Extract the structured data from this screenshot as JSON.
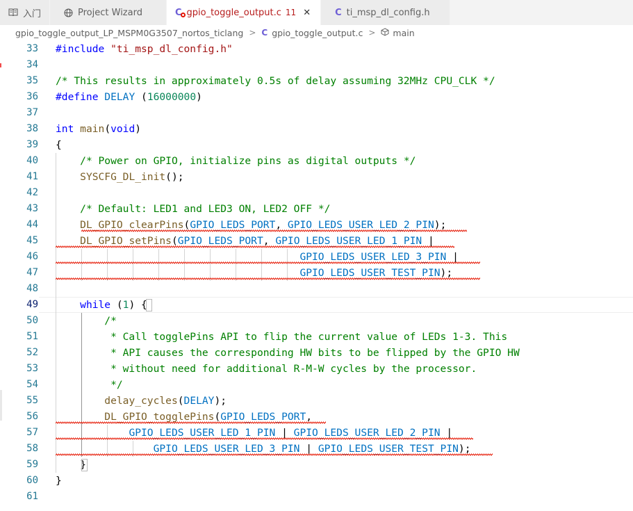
{
  "tabs": [
    {
      "icon": "book-icon",
      "label": "入门",
      "active": false
    },
    {
      "icon": "globe-icon",
      "label": "Project Wizard",
      "active": false
    },
    {
      "icon": "c-file-error-icon",
      "label": "gpio_toggle_output.c",
      "badge": "11",
      "active": true
    },
    {
      "icon": "c-file-icon",
      "label": "ti_msp_dl_config.h",
      "active": false
    }
  ],
  "breadcrumb": {
    "project": "gpio_toggle_output_LP_MSPM0G3507_nortos_ticlang",
    "file": "gpio_toggle_output.c",
    "symbol": "main"
  },
  "editor": {
    "lines": [
      {
        "n": "33",
        "tokens": [
          [
            "pp",
            "#include "
          ],
          [
            "str",
            "\"ti_msp_dl_config.h\""
          ]
        ]
      },
      {
        "n": "34",
        "tokens": []
      },
      {
        "n": "35",
        "tokens": [
          [
            "cm",
            "/* This results in approximately 0.5s of delay assuming 32MHz CPU_CLK */"
          ]
        ]
      },
      {
        "n": "36",
        "tokens": [
          [
            "pp",
            "#define "
          ],
          [
            "mac",
            "DELAY "
          ],
          [
            "pl",
            "("
          ],
          [
            "num",
            "16000000"
          ],
          [
            "pl",
            ")"
          ]
        ]
      },
      {
        "n": "37",
        "tokens": []
      },
      {
        "n": "38",
        "tokens": [
          [
            "kw",
            "int "
          ],
          [
            "fn",
            "main"
          ],
          [
            "pl",
            "("
          ],
          [
            "kw",
            "void"
          ],
          [
            "pl",
            ")"
          ]
        ]
      },
      {
        "n": "39",
        "tokens": [
          [
            "pl",
            "{"
          ]
        ]
      },
      {
        "n": "40",
        "tokens": [
          [
            "pl",
            "    "
          ],
          [
            "cm",
            "/* Power on GPIO, initialize pins as digital outputs */"
          ]
        ]
      },
      {
        "n": "41",
        "tokens": [
          [
            "pl",
            "    "
          ],
          [
            "fn",
            "SYSCFG_DL_init"
          ],
          [
            "pl",
            "();"
          ]
        ]
      },
      {
        "n": "42",
        "tokens": []
      },
      {
        "n": "43",
        "tokens": [
          [
            "pl",
            "    "
          ],
          [
            "cm",
            "/* Default: LED1 and LED3 ON, LED2 OFF */"
          ]
        ]
      },
      {
        "n": "44",
        "tokens": [
          [
            "pl",
            "    "
          ],
          [
            "fn",
            "DL_GPIO_clearPins"
          ],
          [
            "pl",
            "("
          ],
          [
            "mac",
            "GPIO_LEDS_PORT"
          ],
          [
            "pl",
            ", "
          ],
          [
            "mac",
            "GPIO_LEDS_USER_LED_2_PIN"
          ],
          [
            "pl",
            ");"
          ]
        ]
      },
      {
        "n": "45",
        "tokens": [
          [
            "pl",
            "    "
          ],
          [
            "fn",
            "DL_GPIO_setPins"
          ],
          [
            "pl",
            "("
          ],
          [
            "mac",
            "GPIO_LEDS_PORT"
          ],
          [
            "pl",
            ", "
          ],
          [
            "mac",
            "GPIO_LEDS_USER_LED_1_PIN"
          ],
          [
            "pl",
            " |"
          ]
        ]
      },
      {
        "n": "46",
        "tokens": [
          [
            "pl",
            "                                        "
          ],
          [
            "mac",
            "GPIO_LEDS_USER_LED_3_PIN"
          ],
          [
            "pl",
            " |"
          ]
        ]
      },
      {
        "n": "47",
        "tokens": [
          [
            "pl",
            "                                        "
          ],
          [
            "mac",
            "GPIO_LEDS_USER_TEST_PIN"
          ],
          [
            "pl",
            ");"
          ]
        ]
      },
      {
        "n": "48",
        "tokens": []
      },
      {
        "n": "49",
        "tokens": [
          [
            "pl",
            "    "
          ],
          [
            "kw",
            "while"
          ],
          [
            "pl",
            " ("
          ],
          [
            "num",
            "1"
          ],
          [
            "pl",
            ") {"
          ]
        ]
      },
      {
        "n": "50",
        "tokens": [
          [
            "pl",
            "        "
          ],
          [
            "cm",
            "/*"
          ]
        ]
      },
      {
        "n": "51",
        "tokens": [
          [
            "pl",
            "         "
          ],
          [
            "cm",
            "* Call togglePins API to flip the current value of LEDs 1-3. This"
          ]
        ]
      },
      {
        "n": "52",
        "tokens": [
          [
            "pl",
            "         "
          ],
          [
            "cm",
            "* API causes the corresponding HW bits to be flipped by the GPIO HW"
          ]
        ]
      },
      {
        "n": "53",
        "tokens": [
          [
            "pl",
            "         "
          ],
          [
            "cm",
            "* without need for additional R-M-W cycles by the processor."
          ]
        ]
      },
      {
        "n": "54",
        "tokens": [
          [
            "pl",
            "         "
          ],
          [
            "cm",
            "*/"
          ]
        ]
      },
      {
        "n": "55",
        "tokens": [
          [
            "pl",
            "        "
          ],
          [
            "fn",
            "delay_cycles"
          ],
          [
            "pl",
            "("
          ],
          [
            "mac",
            "DELAY"
          ],
          [
            "pl",
            ");"
          ]
        ]
      },
      {
        "n": "56",
        "tokens": [
          [
            "pl",
            "        "
          ],
          [
            "fn",
            "DL_GPIO_togglePins"
          ],
          [
            "pl",
            "("
          ],
          [
            "mac",
            "GPIO_LEDS_PORT"
          ],
          [
            "pl",
            ","
          ]
        ]
      },
      {
        "n": "57",
        "tokens": [
          [
            "pl",
            "            "
          ],
          [
            "mac",
            "GPIO_LEDS_USER_LED_1_PIN"
          ],
          [
            "pl",
            " | "
          ],
          [
            "mac",
            "GPIO_LEDS_USER_LED_2_PIN"
          ],
          [
            "pl",
            " |"
          ]
        ]
      },
      {
        "n": "58",
        "tokens": [
          [
            "pl",
            "                "
          ],
          [
            "mac",
            "GPIO_LEDS_USER_LED_3_PIN"
          ],
          [
            "pl",
            " | "
          ],
          [
            "mac",
            "GPIO_LEDS_USER_TEST_PIN"
          ],
          [
            "pl",
            ");"
          ]
        ]
      },
      {
        "n": "59",
        "tokens": [
          [
            "pl",
            "    }"
          ]
        ]
      },
      {
        "n": "60",
        "tokens": [
          [
            "pl",
            "}"
          ]
        ]
      },
      {
        "n": "61",
        "tokens": []
      }
    ]
  }
}
